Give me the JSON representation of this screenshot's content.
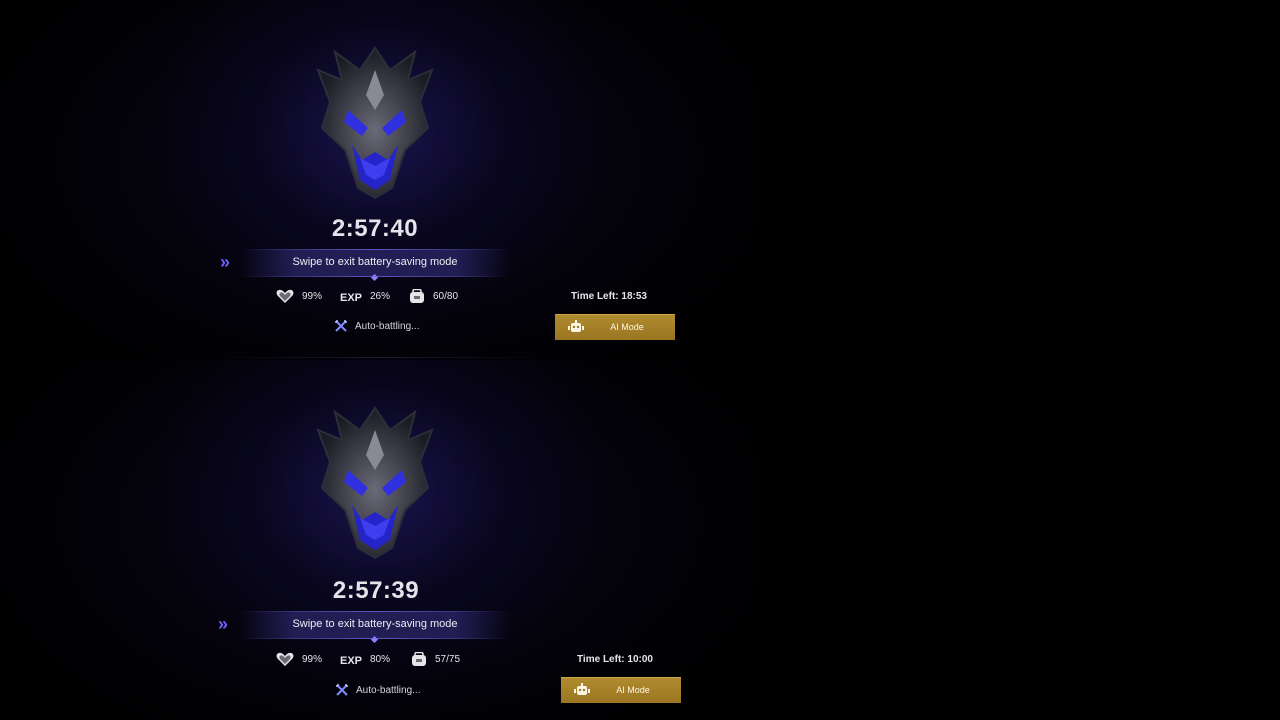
{
  "top": {
    "timer": "2:57:40",
    "swipe_text": "Swipe to exit battery-saving mode",
    "stats": {
      "health": "99%",
      "exp_icon_label": "EXP",
      "exp": "26%",
      "bag": "60/80"
    },
    "auto_status": "Auto-battling...",
    "time_left": "Time Left: 18:53",
    "ai_mode_label": "AI Mode"
  },
  "bottom": {
    "timer": "2:57:39",
    "swipe_text": "Swipe to exit battery-saving mode",
    "stats": {
      "health": "99%",
      "exp_icon_label": "EXP",
      "exp": "80%",
      "bag": "57/75"
    },
    "auto_status": "Auto-battling...",
    "time_left": "Time Left: 10:00",
    "ai_mode_label": "AI Mode"
  },
  "colors": {
    "accent_purple": "#6b62ff",
    "ai_mode_gold": "#a8832a",
    "emblem_blue": "#2b2bd8"
  },
  "icons": [
    "dragon-emblem-icon",
    "double-chevron-icon",
    "heart-icon",
    "exp-icon",
    "bag-icon",
    "crossed-swords-icon",
    "robot-icon"
  ]
}
